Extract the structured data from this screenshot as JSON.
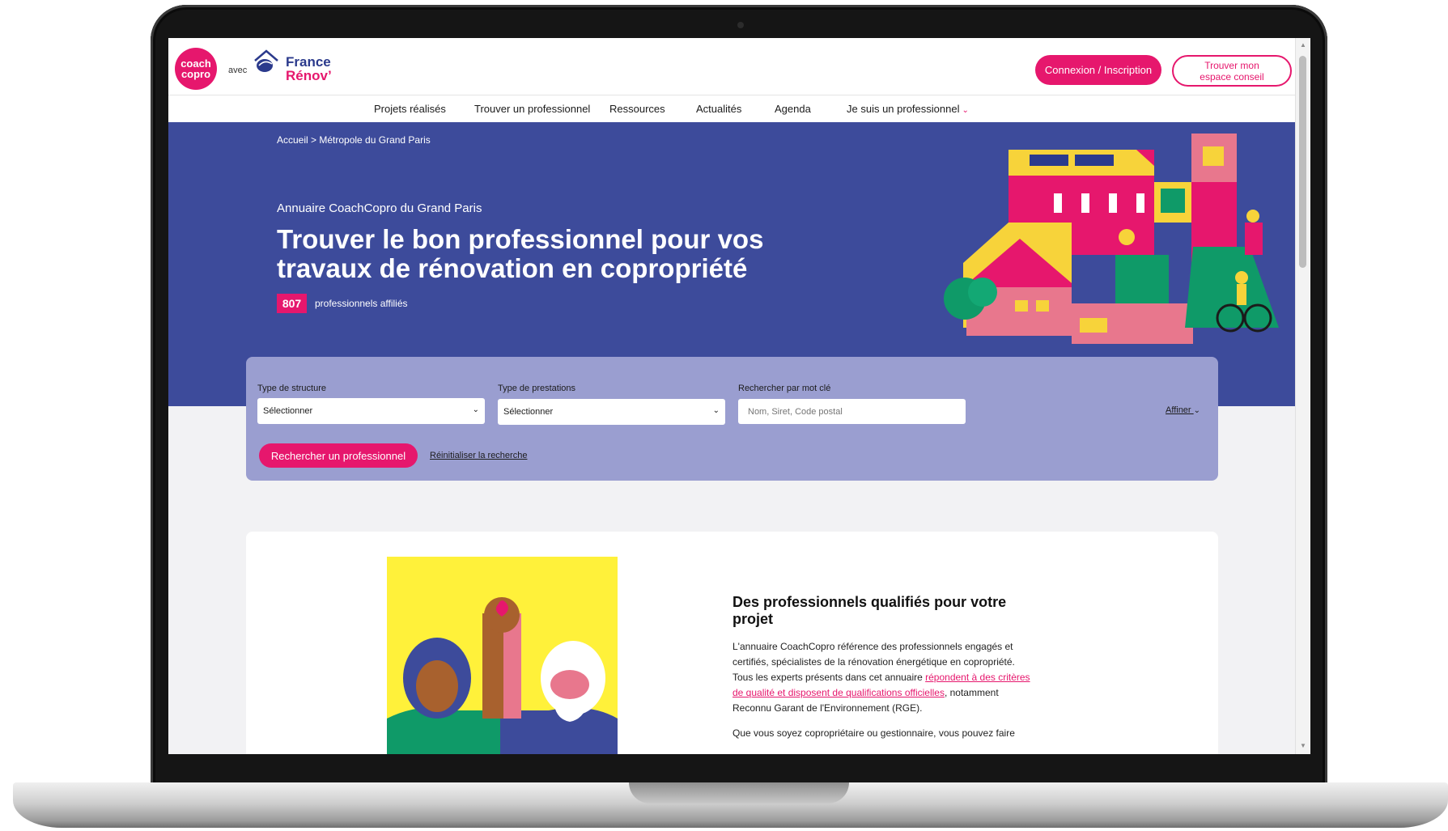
{
  "header": {
    "logo_coach": "coach copro",
    "avec": "avec",
    "france_line1": "France",
    "france_line2": "Rénov’",
    "connexion_label": "Connexion / Inscription",
    "espace_label_line1": "Trouver mon",
    "espace_label_line2": "espace conseil"
  },
  "nav": {
    "items": [
      "Projets réalisés",
      "Trouver un professionnel",
      "Ressources",
      "Actualités",
      "Agenda",
      "Je suis un professionnel"
    ]
  },
  "hero": {
    "breadcrumb": "Accueil > Métropole du Grand Paris",
    "subtitle": "Annuaire CoachCopro du Grand Paris",
    "title": "Trouver le bon professionnel pour vos travaux de rénovation en copropriété",
    "count": "807",
    "count_label": "professionnels affiliés"
  },
  "filters": {
    "structure_label": "Type de structure",
    "structure_value": "Sélectionner",
    "prestations_label": "Type de prestations",
    "prestations_value": "Sélectionner",
    "keyword_label": "Rechercher par mot clé",
    "keyword_placeholder": "Nom, Siret, Code postal",
    "affiner_label": "Affiner",
    "search_button": "Rechercher un professionnel",
    "reset_link": "Réinitialiser la recherche"
  },
  "card": {
    "title": "Des professionnels qualifiés pour votre projet",
    "p1_before": "L'annuaire CoachCopro référence des professionnels engagés et certifiés, spécialistes de la rénovation énergétique en copropriété. Tous les experts présents dans cet annuaire ",
    "p1_link": "répondent à des critères de qualité et disposent de qualifications officielles",
    "p1_after": ", notamment Reconnu Garant de l'Environnement (RGE).",
    "p2": "Que vous soyez copropriétaire ou gestionnaire, vous pouvez faire"
  },
  "colors": {
    "brand_pink": "#e6176d",
    "hero_blue": "#3d4b9b",
    "filter_lavender": "#9a9ed0"
  },
  "icons": {
    "nav_dropdown": "chevron-down-icon",
    "select_dropdown": "chevron-down-icon",
    "france_renov_logo": "house-roof-icon"
  }
}
